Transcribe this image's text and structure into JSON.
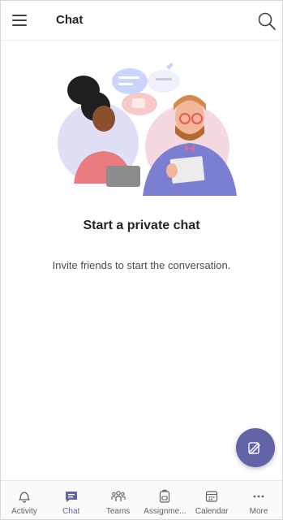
{
  "header": {
    "title": "Chat"
  },
  "empty_state": {
    "title": "Start a private chat",
    "subtitle": "Invite friends to start the conversation."
  },
  "bottom_nav": {
    "items": [
      {
        "label": "Activity",
        "icon": "bell-icon",
        "active": false
      },
      {
        "label": "Chat",
        "icon": "chat-icon",
        "active": true
      },
      {
        "label": "Teams",
        "icon": "teams-icon",
        "active": false
      },
      {
        "label": "Assignme...",
        "icon": "assignments-icon",
        "active": false
      },
      {
        "label": "Calendar",
        "icon": "calendar-icon",
        "active": false
      },
      {
        "label": "More",
        "icon": "more-icon",
        "active": false
      }
    ]
  },
  "colors": {
    "accent": "#6264a7",
    "text": "#242424",
    "muted": "#616161"
  }
}
